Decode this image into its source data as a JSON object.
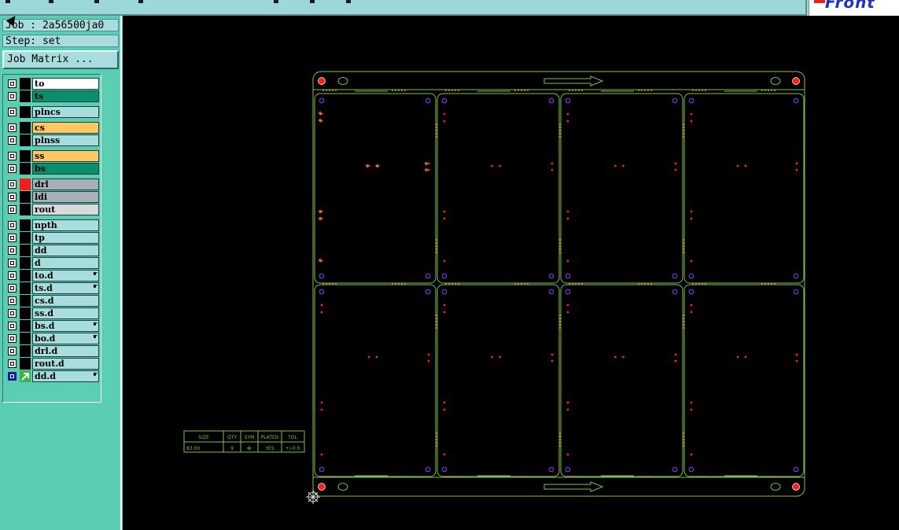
{
  "toolbar": {
    "logo_text": "Front"
  },
  "info": {
    "job": "Job : 2a56500ja0",
    "step": "Step: set"
  },
  "job_matrix_button": "Job Matrix ...",
  "layers": [
    {
      "name": "to",
      "color": "#ffffff",
      "swatch": "#000000",
      "checked": true
    },
    {
      "name": "ts",
      "color": "#0a8f6e",
      "swatch": "#000000",
      "checked": true
    },
    {
      "name": "plncs",
      "color": "#a9dcdc",
      "swatch": "#000000",
      "checked": true
    },
    {
      "name": "cs",
      "color": "#ffc861",
      "swatch": "#000000",
      "checked": true
    },
    {
      "name": "plnss",
      "color": "#a9dcdc",
      "swatch": "#000000",
      "checked": true
    },
    {
      "name": "ss",
      "color": "#ffc861",
      "swatch": "#000000",
      "checked": true
    },
    {
      "name": "bs",
      "color": "#0a8f6e",
      "swatch": "#000000",
      "checked": true
    },
    {
      "name": "drl",
      "color": "#a7b0b9",
      "swatch": "#ff1a1a",
      "checked": true
    },
    {
      "name": "ldi",
      "color": "#a7b0b9",
      "swatch": "#000000",
      "checked": true
    },
    {
      "name": "rout",
      "color": "#d9d9d9",
      "swatch": "#000000",
      "checked": true
    },
    {
      "name": "npth",
      "color": "#a9dcdc",
      "swatch": "#000000",
      "checked": true
    },
    {
      "name": "tp",
      "color": "#a9dcdc",
      "swatch": "#000000",
      "checked": true
    },
    {
      "name": "dd",
      "color": "#a9dcdc",
      "swatch": "#000000",
      "checked": true
    },
    {
      "name": "d",
      "color": "#a9dcdc",
      "swatch": "#000000",
      "checked": true
    },
    {
      "name": "to.d",
      "color": "#a9dcdc",
      "swatch": "#000000",
      "checked": true,
      "hand": true
    },
    {
      "name": "ts.d",
      "color": "#a9dcdc",
      "swatch": "#000000",
      "checked": true,
      "hand": true
    },
    {
      "name": "cs.d",
      "color": "#a9dcdc",
      "swatch": "#000000",
      "checked": true
    },
    {
      "name": "ss.d",
      "color": "#a9dcdc",
      "swatch": "#000000",
      "checked": true
    },
    {
      "name": "bs.d",
      "color": "#a9dcdc",
      "swatch": "#000000",
      "checked": true,
      "hand": true
    },
    {
      "name": "bo.d",
      "color": "#a9dcdc",
      "swatch": "#000000",
      "checked": true,
      "hand": true
    },
    {
      "name": "drl.d",
      "color": "#a9dcdc",
      "swatch": "#000000",
      "checked": true
    },
    {
      "name": "rout.d",
      "color": "#a9dcdc",
      "swatch": "#000000",
      "checked": true
    },
    {
      "name": "dd.d",
      "color": "#a9dcdc",
      "swatch": "#3cb34a",
      "checked": true,
      "selected": true,
      "hand": true
    }
  ],
  "drill_table": {
    "headers": [
      "SIZE",
      "QTY",
      "SYM",
      "PLATED",
      "TOL"
    ],
    "row": [
      "83.00",
      "9",
      "+",
      "YES",
      "+/-0.0"
    ]
  },
  "colors": {
    "outline": "#7fbf4d",
    "dots": "#d08a3a",
    "red_pads": "#ff2020",
    "purple_pads": "#8a3cff",
    "orange_marks": "#ffaa33"
  }
}
